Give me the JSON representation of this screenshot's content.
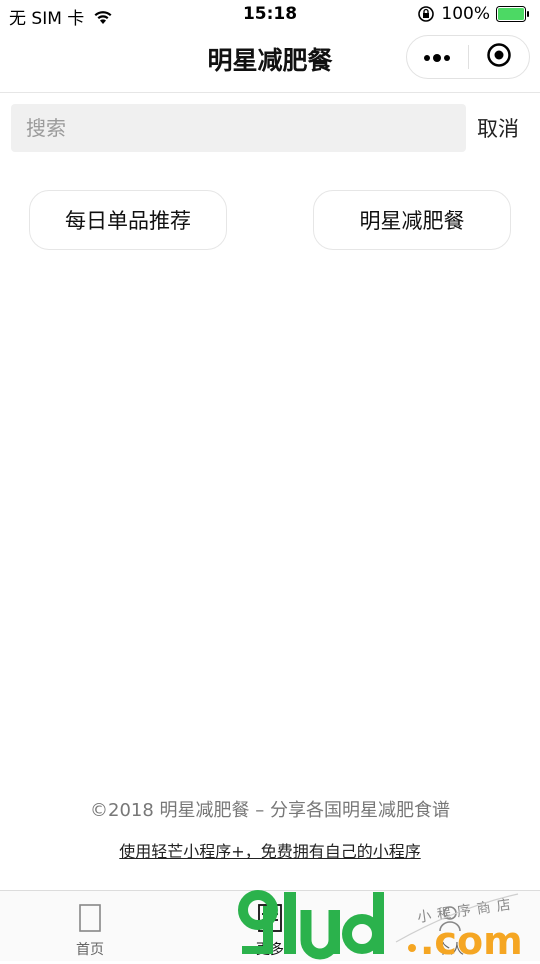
{
  "status_bar": {
    "carrier": "无 SIM 卡",
    "time": "15:18",
    "battery": "100%",
    "battery_level": 1.0
  },
  "nav": {
    "title": "明星减肥餐",
    "more_icon": "more-dots-icon",
    "close_icon": "target-close-icon"
  },
  "search": {
    "placeholder": "搜索",
    "value": "",
    "cancel_label": "取消"
  },
  "tags": [
    {
      "label": "每日单品推荐"
    },
    {
      "label": "明星减肥餐"
    }
  ],
  "footer": {
    "copyright": "©2018 明星减肥餐 – 分享各国明星减肥食谱",
    "link": "使用轻芒小程序+，免费拥有自己的小程序"
  },
  "tab_bar": {
    "items": [
      {
        "label": "首页",
        "icon": "page-icon"
      },
      {
        "label": "更多",
        "icon": "list-icon"
      },
      {
        "label": "个人",
        "icon": "person-icon"
      }
    ],
    "active_index": 1
  },
  "watermark": {
    "logo": "91ud",
    "domain": ".com",
    "tagline": "小程序商店"
  },
  "colors": {
    "watermark_green": "#2bb24c",
    "watermark_orange": "#f5a623",
    "battery_green": "#4cd964"
  }
}
